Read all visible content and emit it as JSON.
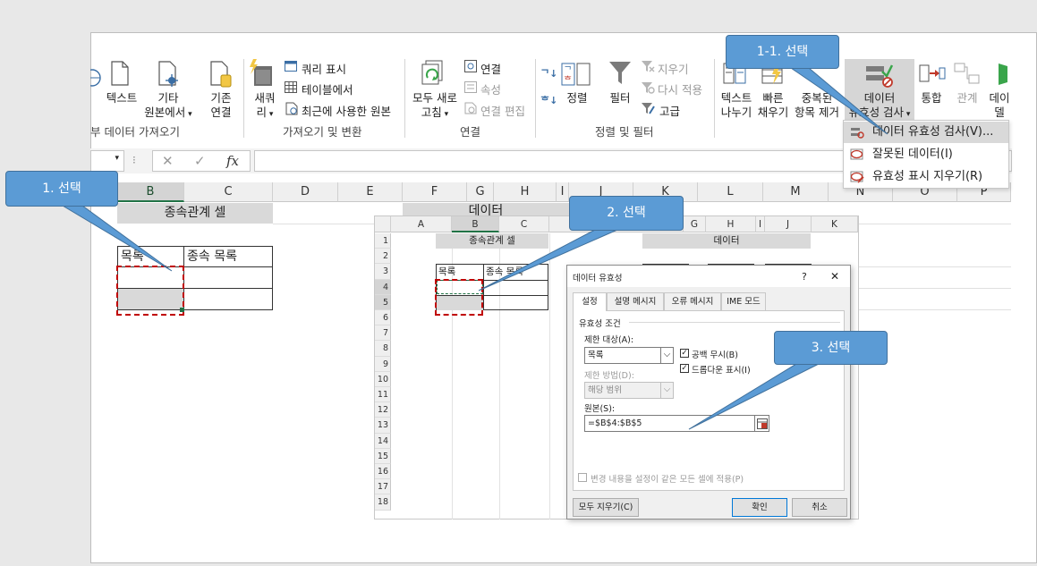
{
  "colors": {
    "callout": "#5b9bd5",
    "callout_border": "#41719c",
    "dash_highlight": "#c00000",
    "header_gray": "#d9d9d9",
    "excel_green": "#217346"
  },
  "ribbon": {
    "get_external_data": {
      "text_label": "텍스트",
      "other_sources_label": "기타\n원본에서",
      "group_label": "부 데이터 가져오기"
    },
    "get_transform": {
      "existing_connections_label": "기존\n연결",
      "new_query_label": "새쿼\n리",
      "show_queries": "쿼리 표시",
      "from_table": "테이블에서",
      "recent_sources": "최근에 사용한 원본",
      "group_label": "가져오기 및 변환"
    },
    "connections": {
      "refresh_all_label": "모두 새로\n고침",
      "connections": "연결",
      "properties": "속성",
      "edit_links": "연결 편집",
      "group_label": "연결"
    },
    "sort_filter": {
      "sort_label": "정렬",
      "filter_label": "필터",
      "clear": "지우기",
      "reapply": "다시 적용",
      "advanced": "고급",
      "group_label": "정렬 및 필터"
    },
    "data_tools": {
      "text_to_columns_label": "텍스트\n나누기",
      "flash_fill_label": "빠른\n채우기",
      "remove_duplicates_label": "중복된\n항목 제거",
      "data_validation_label": "데이터\n유효성 검사",
      "consolidate_label": "통합",
      "relationships_label": "관계",
      "data_model_label": "데이\n델"
    }
  },
  "validation_menu": {
    "items": [
      "데이터 유효성 검사(V)...",
      "잘못된 데이터(I)",
      "유효성 표시 지우기(R)"
    ]
  },
  "formula_bar": {
    "fx": "fx",
    "cancel": "✕",
    "enter": "✓"
  },
  "sheet": {
    "columns": [
      "B",
      "C",
      "D",
      "E",
      "F",
      "G",
      "H",
      "I",
      "J",
      "K",
      "L",
      "M",
      "N",
      "O",
      "P"
    ],
    "dependent_header": "종속관계 셀",
    "data_header": "데이터",
    "list_label": "목록",
    "dependent_list_label": "종속 목록"
  },
  "inset": {
    "columns": [
      "A",
      "B",
      "C",
      "D",
      "G",
      "H",
      "I",
      "J",
      "K"
    ],
    "rows": [
      "1",
      "2",
      "3",
      "4",
      "5",
      "6",
      "7",
      "8",
      "9",
      "10",
      "11",
      "12",
      "13",
      "14",
      "15",
      "16",
      "17",
      "18"
    ],
    "dependent_header": "종속관계 셀",
    "data_header": "데이터",
    "list_label": "목록",
    "dependent_list_label": "종속 목록"
  },
  "dialog": {
    "title": "데이터 유효성",
    "help": "?",
    "close": "✕",
    "tabs": [
      "설정",
      "설명 메시지",
      "오류 메시지",
      "IME 모드"
    ],
    "criteria_title": "유효성 조건",
    "allow_label": "제한 대상(A):",
    "allow_value": "목록",
    "ignore_blank": "공백 무시(B)",
    "in_cell_dropdown": "드롭다운 표시(I)",
    "data_label": "제한 방법(D):",
    "data_value": "해당 범위",
    "source_label": "원본(S):",
    "source_value": "=$B$4:$B$5",
    "apply_all": "변경 내용을 설정이 같은 모든 셀에 적용(P)",
    "clear_all": "모두 지우기(C)",
    "ok": "확인",
    "cancel": "취소"
  },
  "callouts": {
    "step1": "1. 선택",
    "step1_1": "1-1. 선택",
    "step2": "2. 선택",
    "step3": "3. 선택"
  }
}
